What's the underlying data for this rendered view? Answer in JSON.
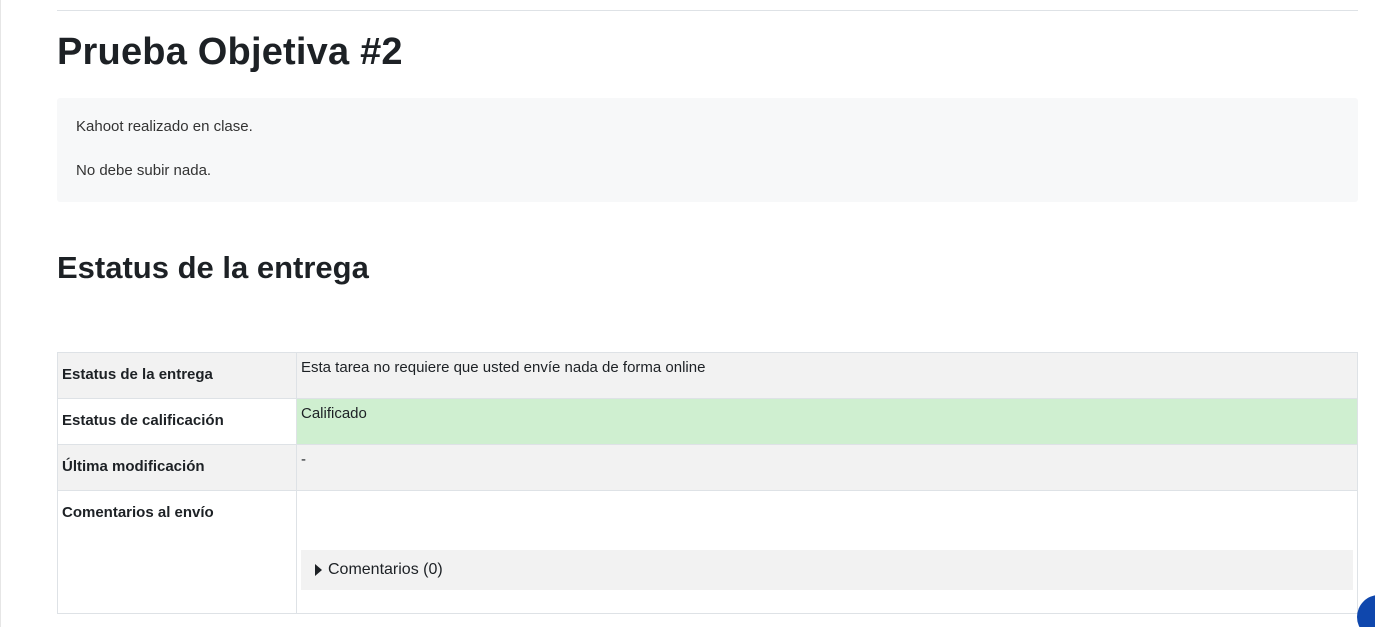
{
  "page": {
    "title": "Prueba Objetiva #2"
  },
  "intro": {
    "paragraphs": [
      "Kahoot realizado en clase.",
      "No debe subir nada."
    ]
  },
  "submission": {
    "section_title": "Estatus de la entrega",
    "rows": [
      {
        "label": "Estatus de la entrega",
        "value": "Esta tarea no requiere que usted envíe nada de forma online"
      },
      {
        "label": "Estatus de calificación",
        "value": "Calificado"
      },
      {
        "label": "Última modificación",
        "value": "-"
      },
      {
        "label": "Comentarios al envío",
        "value": ""
      }
    ],
    "comments_toggle_label": "Comentarios (0)"
  },
  "colors": {
    "graded_status": "#cfefd0",
    "fab": "#0f47ad"
  },
  "icons": {
    "comments_toggle": "caret-right-icon",
    "fab": "help-icon"
  }
}
